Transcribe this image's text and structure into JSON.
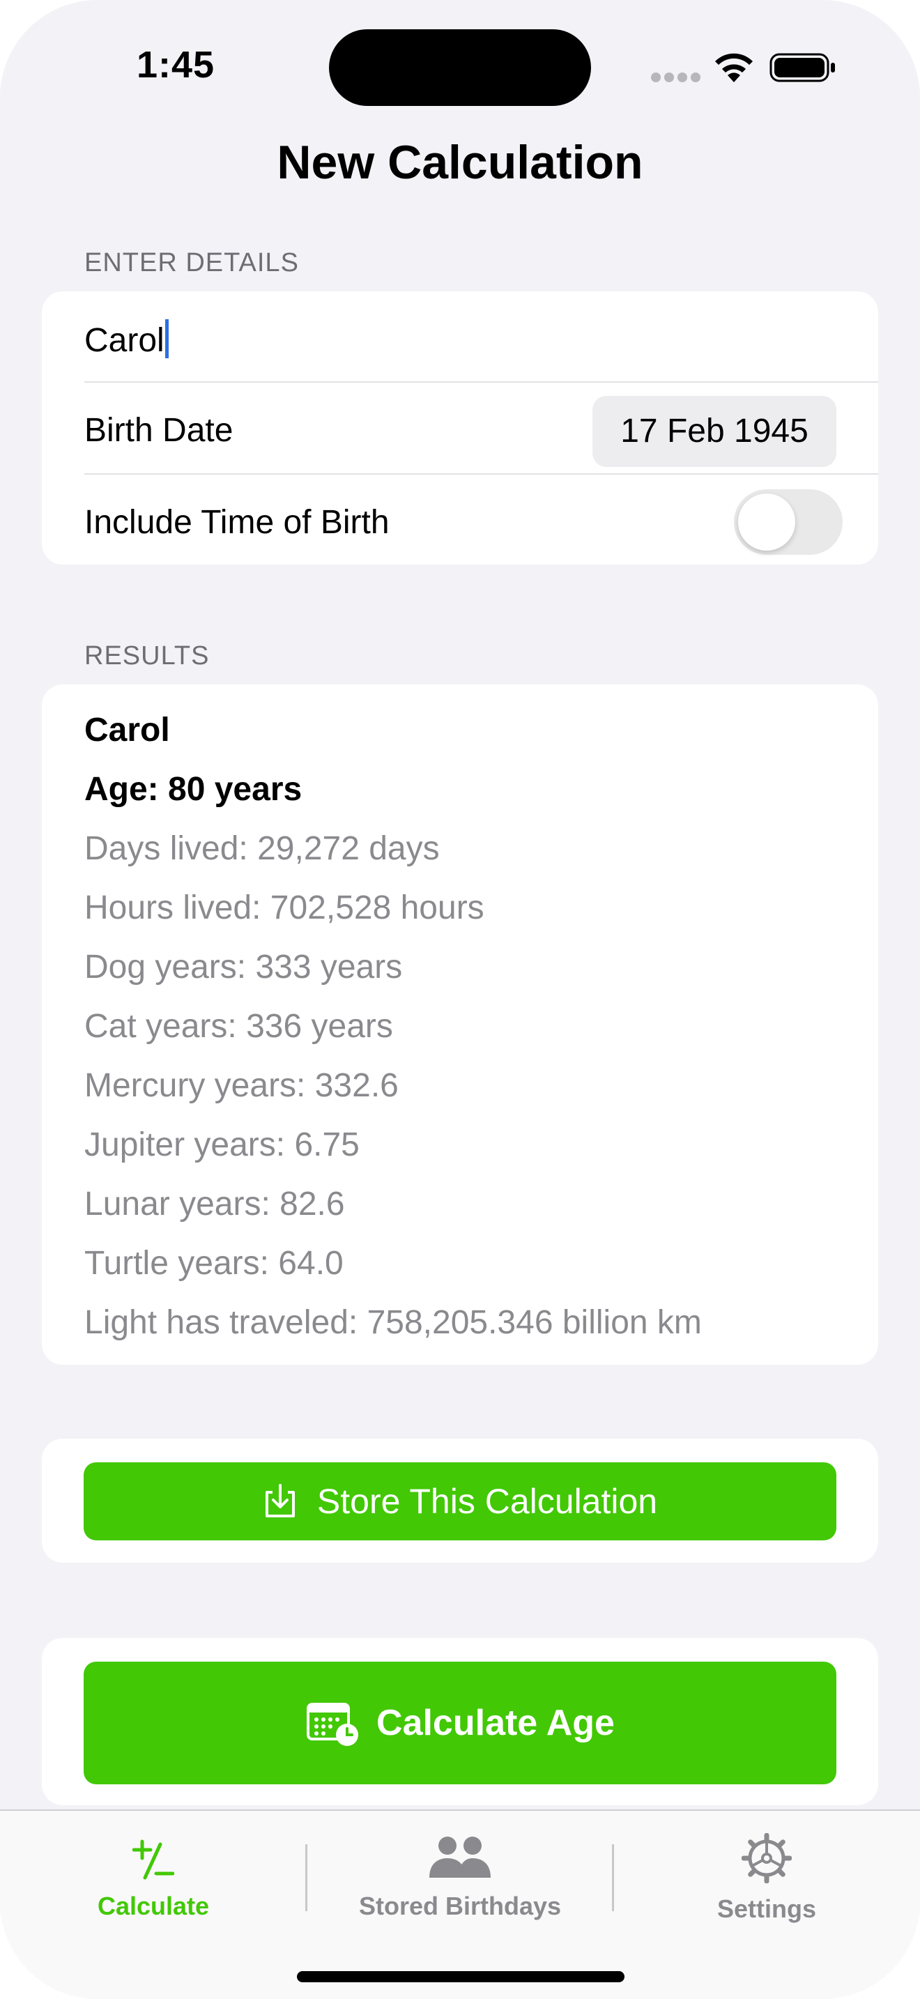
{
  "status_bar": {
    "time": "1:45"
  },
  "nav": {
    "title": "New Calculation"
  },
  "details": {
    "header": "ENTER DETAILS",
    "name_value": "Carol",
    "birth_date_label": "Birth Date",
    "birth_date_value": "17 Feb 1945",
    "include_time_label": "Include Time of Birth",
    "include_time_on": false
  },
  "results": {
    "header": "RESULTS",
    "name": "Carol",
    "age": "Age: 80 years",
    "days": "Days lived: 29,272 days",
    "hours": "Hours lived: 702,528 hours",
    "dog": "Dog years: 333 years",
    "cat": "Cat years: 336 years",
    "mercury": "Mercury years: 332.6",
    "jupiter": "Jupiter years: 6.75",
    "lunar": "Lunar years: 82.6",
    "turtle": "Turtle years: 64.0",
    "light": "Light has traveled: 758,205.346 billion km"
  },
  "actions": {
    "store_label": "Store This Calculation",
    "calculate_label": "Calculate Age"
  },
  "tabs": {
    "calculate_label": "Calculate",
    "calculate_icon": "+/−",
    "stored_label": "Stored Birthdays",
    "settings_label": "Settings"
  },
  "colors": {
    "accent_green": "#42c805",
    "cursor_blue": "#2d6fe0"
  }
}
